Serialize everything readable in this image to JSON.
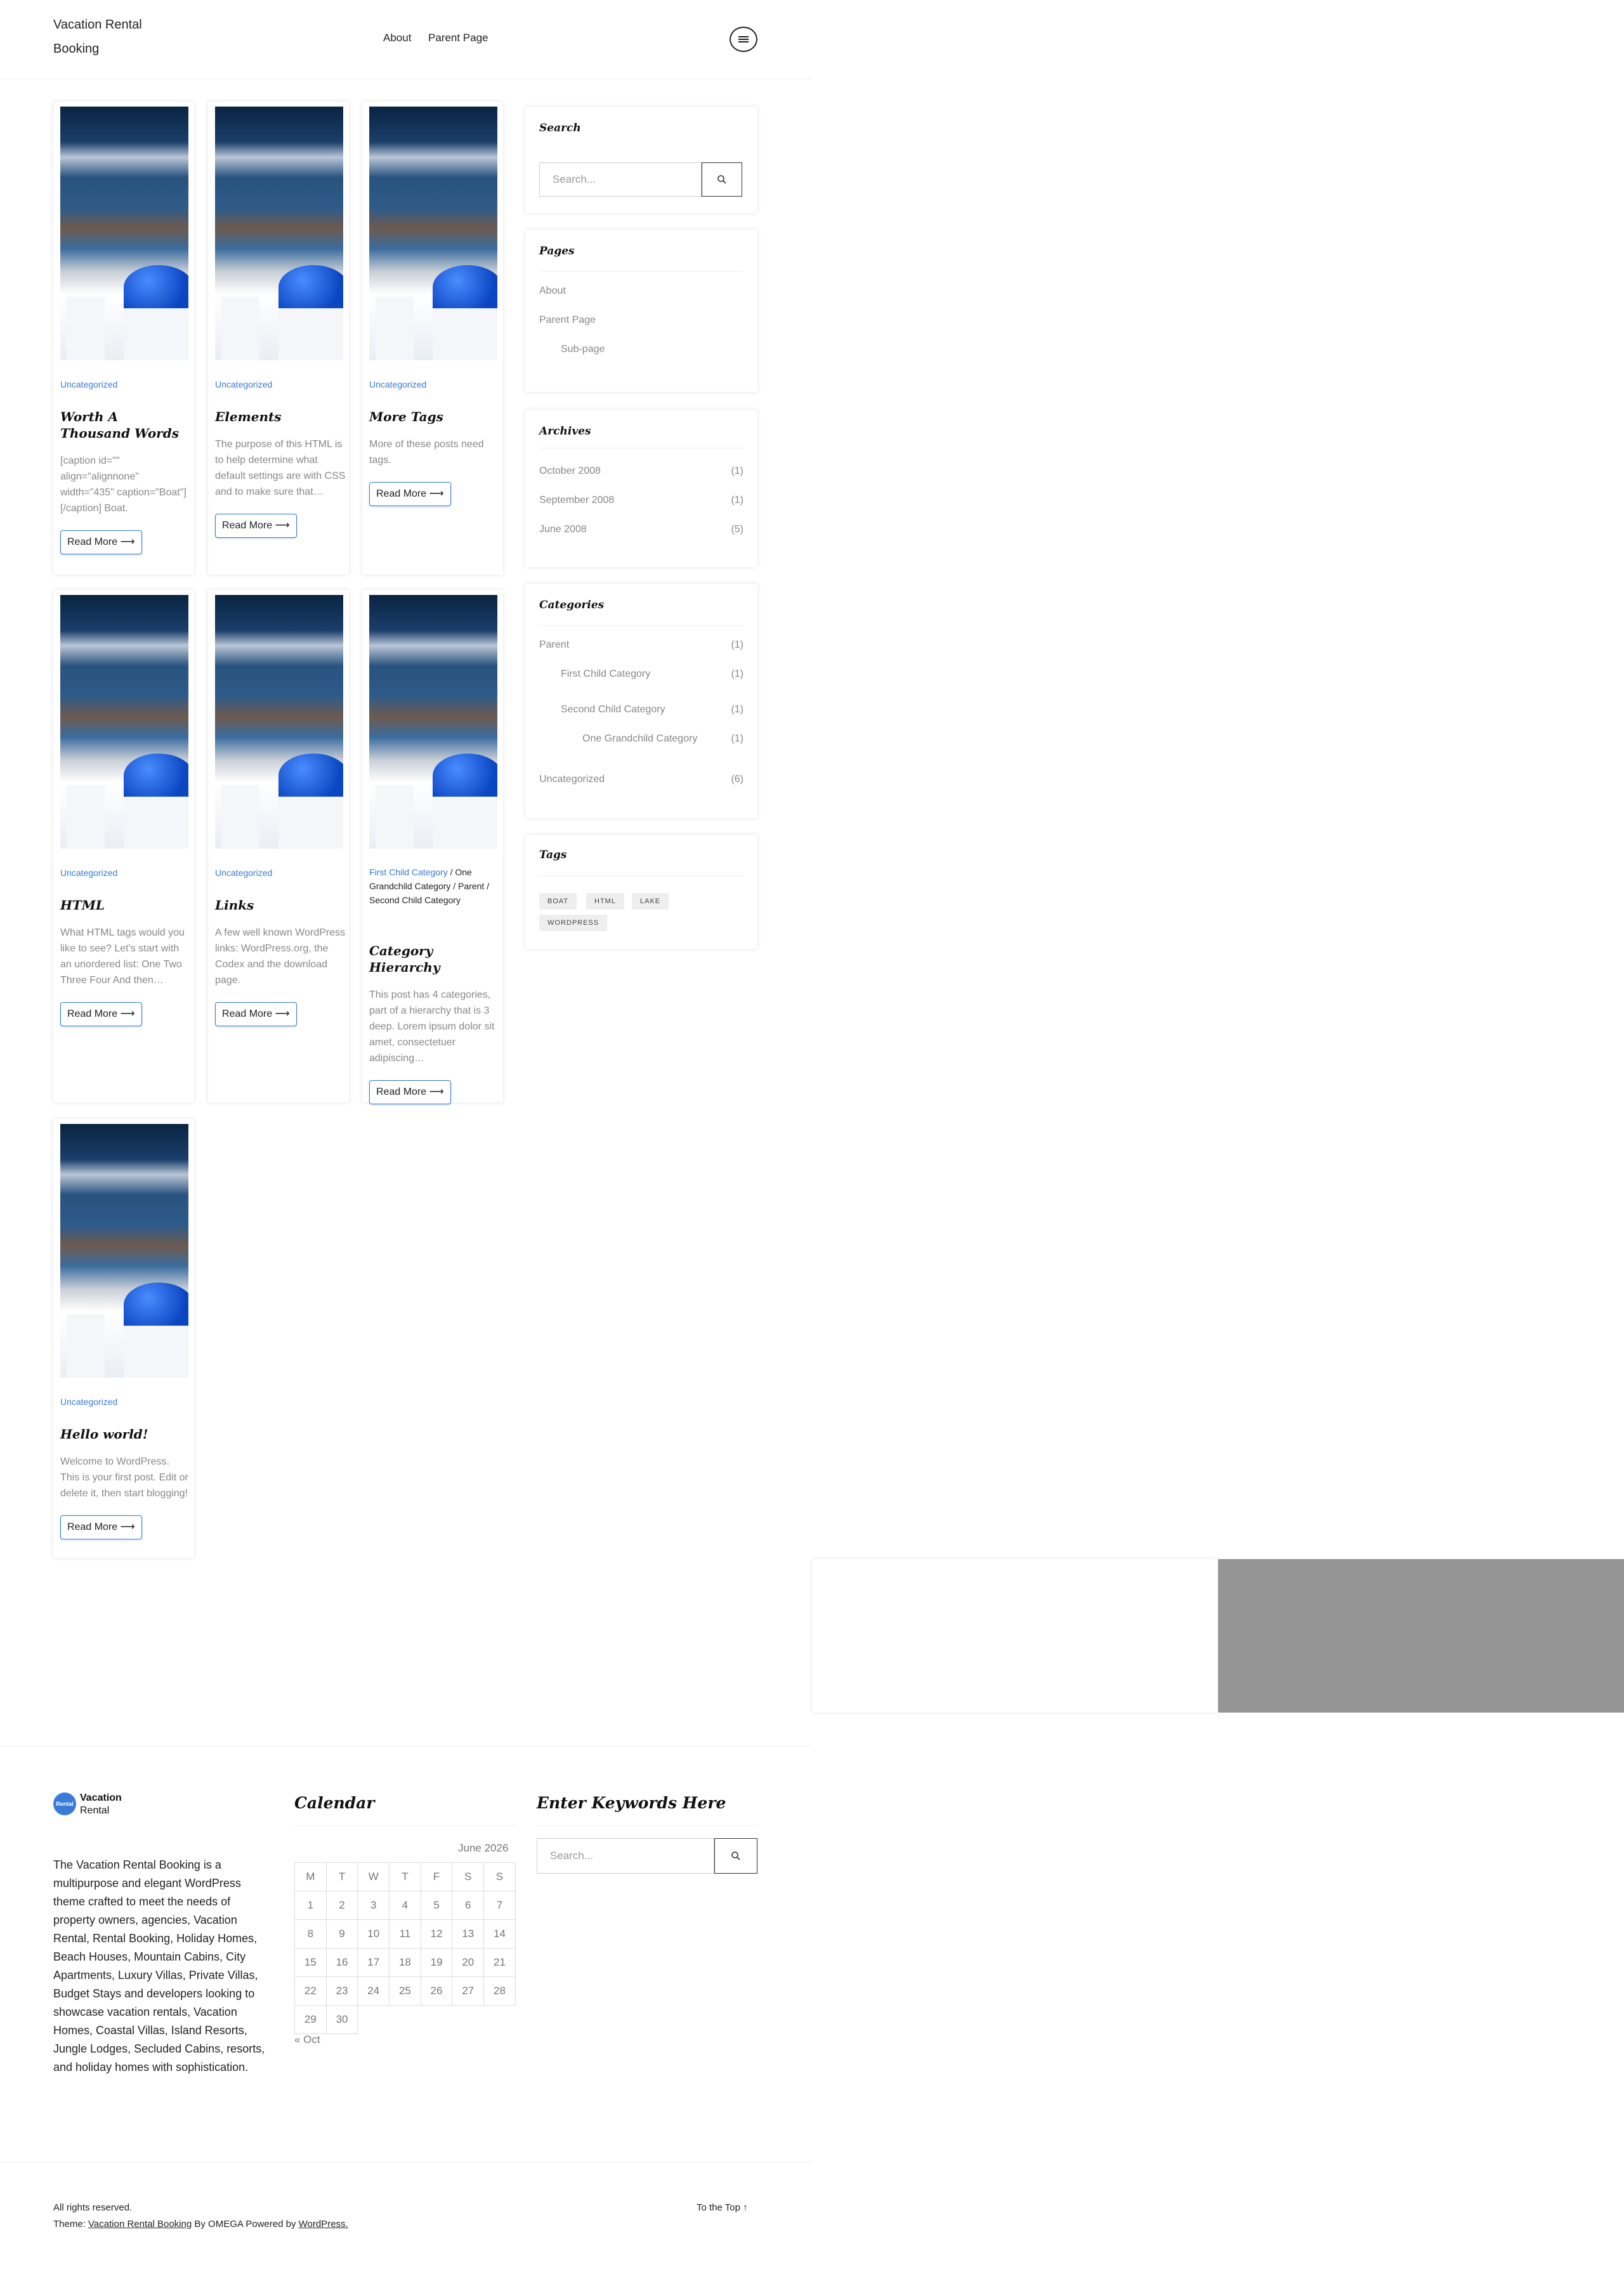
{
  "header": {
    "site_title": "Vacation Rental Booking",
    "nav": [
      "About",
      "Parent Page"
    ]
  },
  "posts": [
    {
      "category": "Uncategorized",
      "title": "Worth A Thousand Words",
      "excerpt": "[caption id=\"\" align=\"alignnone\" width=\"435\" caption=\"Boat\"][/caption] Boat.",
      "read_more": "Read More ⟶"
    },
    {
      "category": "Uncategorized",
      "title": "Elements",
      "excerpt": "The purpose of this HTML is to help determine what default settings are with CSS and to make sure that…",
      "read_more": "Read More ⟶"
    },
    {
      "category": "Uncategorized",
      "title": "More Tags",
      "excerpt": "More of these posts need tags.",
      "read_more": "Read More ⟶"
    },
    {
      "category": "Uncategorized",
      "title": "HTML",
      "excerpt": "What HTML tags would you like to see? Let's start with an unordered list: One Two Three Four And then…",
      "read_more": "Read More ⟶"
    },
    {
      "category": "Uncategorized",
      "title": "Links",
      "excerpt": "A few well known WordPress links: WordPress.org, the Codex and the download page.",
      "read_more": "Read More ⟶"
    },
    {
      "categories": [
        "First Child Category",
        "One Grandchild Category",
        "Parent",
        "Second Child Category"
      ],
      "title": "Category Hierarchy",
      "excerpt": "This post has 4 categories, part of a hierarchy that is 3 deep. Lorem ipsum dolor sit amet, consectetuer adipiscing…",
      "read_more": "Read More ⟶"
    },
    {
      "category": "Uncategorized",
      "title": "Hello world!",
      "excerpt": "Welcome to WordPress. This is your first post. Edit or delete it, then start blogging!",
      "read_more": "Read More ⟶"
    }
  ],
  "sidebar": {
    "search": {
      "title": "Search",
      "placeholder": "Search..."
    },
    "pages": {
      "title": "Pages",
      "items": [
        "About",
        "Parent Page",
        "Sub-page"
      ]
    },
    "archives": {
      "title": "Archives",
      "items": [
        {
          "label": "October 2008",
          "count": "(1)"
        },
        {
          "label": "September 2008",
          "count": "(1)"
        },
        {
          "label": "June 2008",
          "count": "(5)"
        }
      ]
    },
    "categories": {
      "title": "Categories",
      "items": [
        {
          "label": "Parent",
          "count": "(1)"
        },
        {
          "label": "First Child Category",
          "count": "(1)"
        },
        {
          "label": "Second Child Category",
          "count": "(1)"
        },
        {
          "label": "One Grandchild Category",
          "count": "(1)"
        },
        {
          "label": "Uncategorized",
          "count": "(6)"
        }
      ]
    },
    "tags": {
      "title": "Tags",
      "items": [
        "BOAT",
        "HTML",
        "LAKE",
        "WORDPRESS"
      ]
    }
  },
  "footer": {
    "logo_line1": "Vacation",
    "logo_line2": "Rental",
    "logo_badge": "Rental",
    "about": "The Vacation Rental Booking is a multipurpose and elegant WordPress theme crafted to meet the needs of property owners, agencies, Vacation Rental, Rental Booking, Holiday Homes, Beach Houses, Mountain Cabins, City Apartments, Luxury Villas, Private Villas, Budget Stays and developers looking to showcase vacation rentals, Vacation Homes, Coastal Villas, Island Resorts, Jungle Lodges, Secluded Cabins, resorts, and holiday homes with sophistication.",
    "calendar": {
      "title": "Calendar",
      "caption": "June 2026",
      "days": [
        "M",
        "T",
        "W",
        "T",
        "F",
        "S",
        "S"
      ],
      "weeks": [
        [
          "1",
          "2",
          "3",
          "4",
          "5",
          "6",
          "7"
        ],
        [
          "8",
          "9",
          "10",
          "11",
          "12",
          "13",
          "14"
        ],
        [
          "15",
          "16",
          "17",
          "18",
          "19",
          "20",
          "21"
        ],
        [
          "22",
          "23",
          "24",
          "25",
          "26",
          "27",
          "28"
        ],
        [
          "29",
          "30",
          "",
          "",
          "",
          "",
          ""
        ]
      ],
      "prev": "« Oct"
    },
    "search": {
      "title": "Enter Keywords Here",
      "placeholder": "Search..."
    },
    "rights": "All rights reserved.",
    "theme_prefix": "Theme:",
    "theme_link": "Vacation Rental Booking",
    "theme_by": "By OMEGA Powered by",
    "wp_link": "WordPress.",
    "to_top": "To the Top ↑"
  },
  "colors": {
    "accent": "#3a7bd5",
    "dark": "#222222",
    "overlay_gray": "#959595"
  }
}
